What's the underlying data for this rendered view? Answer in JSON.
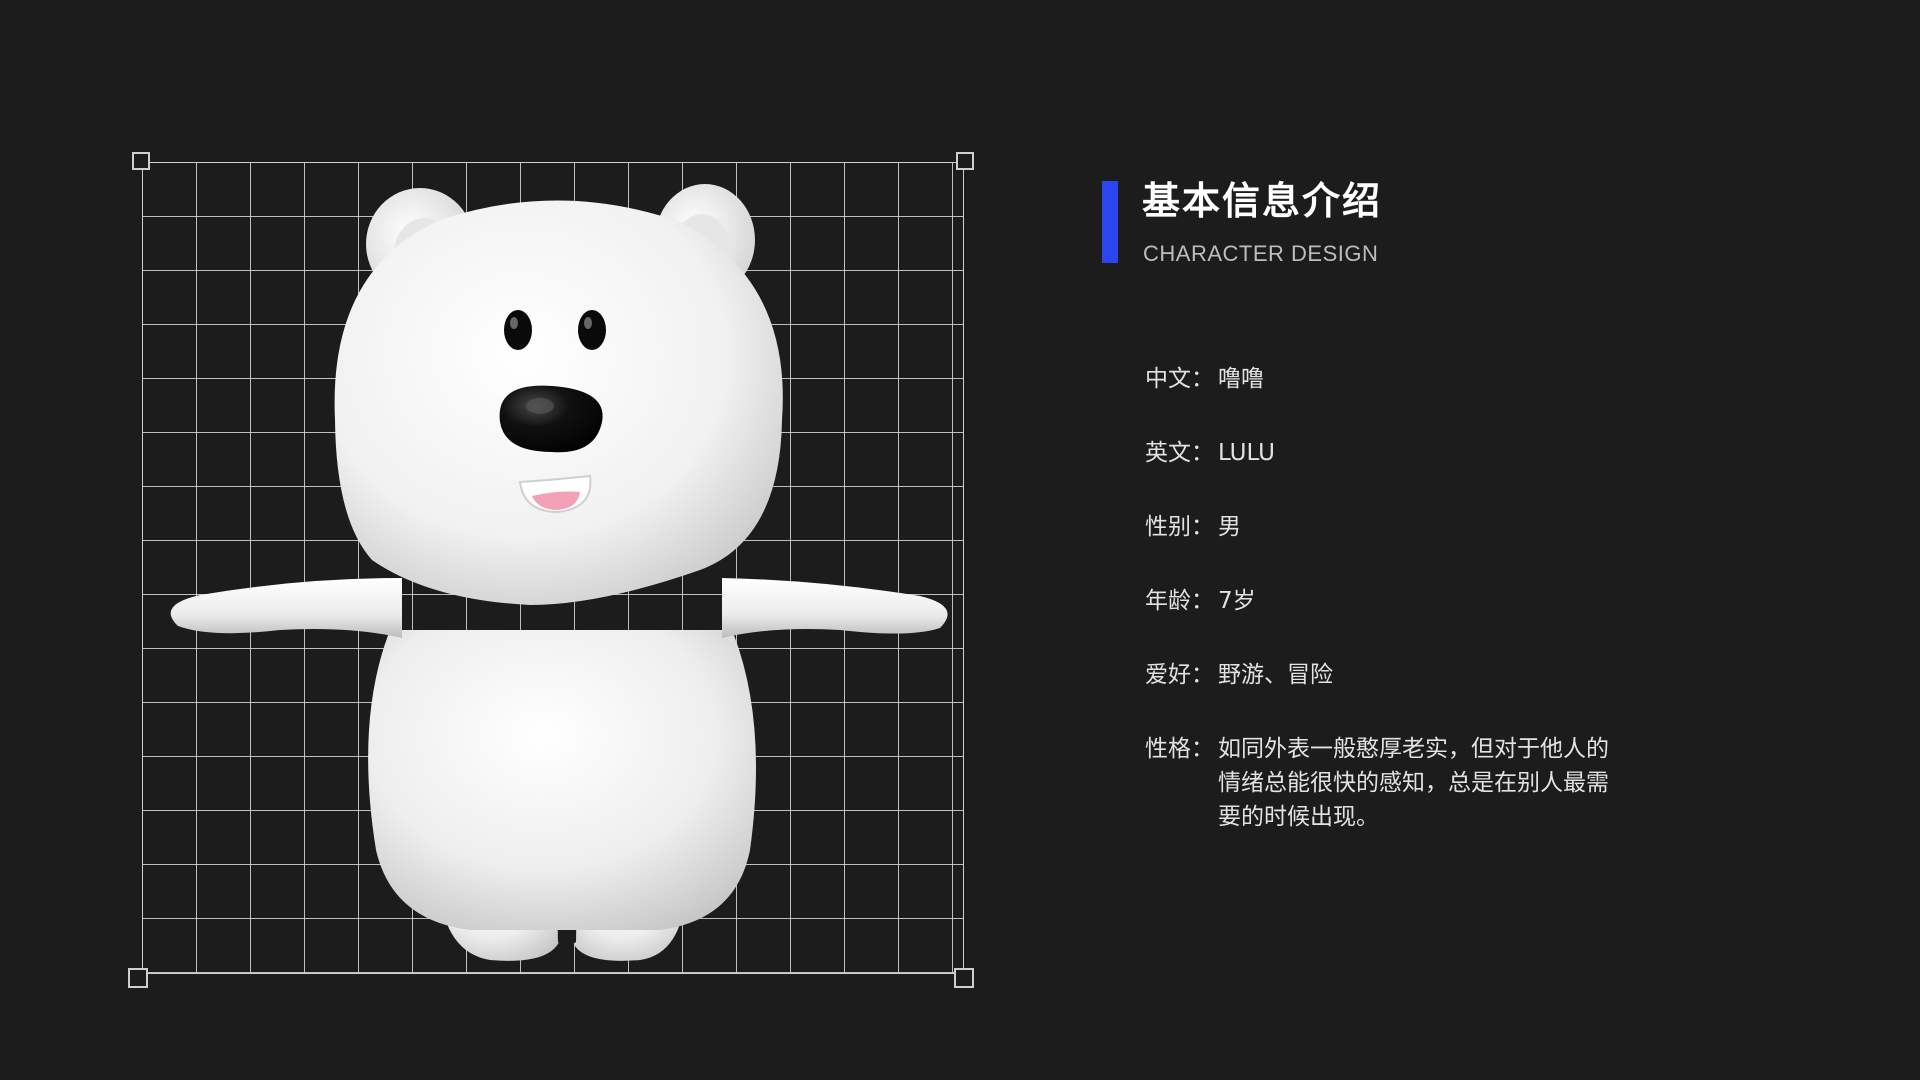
{
  "header": {
    "title": "基本信息介绍",
    "subtitle": "CHARACTER DESIGN",
    "accent_color": "#2b45f0"
  },
  "figure": {
    "description_icon": "polar-bear-3d-model",
    "grid": true
  },
  "info": {
    "separator": "：",
    "items": [
      {
        "label": "中文",
        "value": "噜噜"
      },
      {
        "label": "英文",
        "value": "LULU"
      },
      {
        "label": "性别",
        "value": "男"
      },
      {
        "label": "年龄",
        "value": "7岁"
      },
      {
        "label": "爱好",
        "value": "野游、冒险"
      },
      {
        "label": "性格",
        "value": "如同外表一般憨厚老实，但对于他人的情绪总能很快的感知，总是在别人最需要的时候出现。"
      }
    ]
  }
}
